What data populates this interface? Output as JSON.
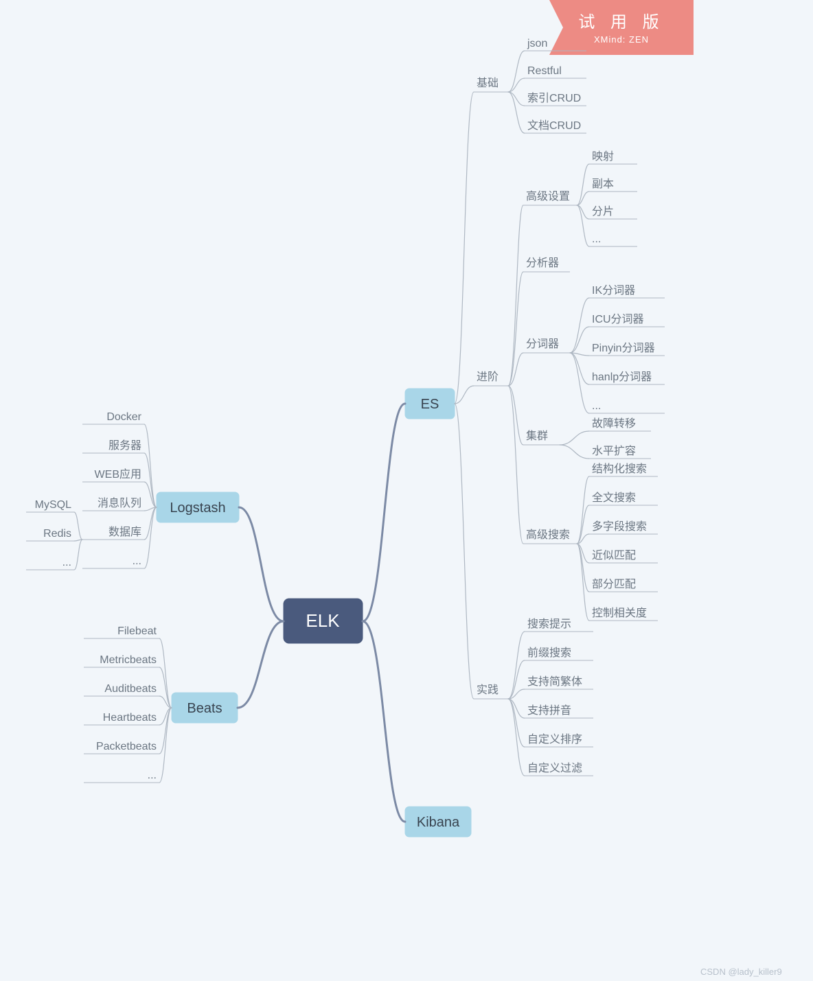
{
  "watermark": {
    "title": "试 用 版",
    "subtitle": "XMind: ZEN"
  },
  "footer": "CSDN @lady_killer9",
  "root": "ELK",
  "branches": {
    "logstash": "Logstash",
    "beats": "Beats",
    "es": "ES",
    "kibana": "Kibana"
  },
  "logstash_children": [
    "Docker",
    "服务器",
    "WEB应用",
    "消息队列",
    "数据库",
    "..."
  ],
  "database_children": [
    "MySQL",
    "Redis",
    "..."
  ],
  "beats_children": [
    "Filebeat",
    "Metricbeats",
    "Auditbeats",
    "Heartbeats",
    "Packetbeats",
    "..."
  ],
  "es_children": {
    "basic": "基础",
    "advanced": "进阶",
    "practice": "实践"
  },
  "basic_children": [
    "json",
    "Restful",
    "索引CRUD",
    "文档CRUD"
  ],
  "advanced_children": {
    "settings": "高级设置",
    "analyzer": "分析器",
    "tokenizer": "分词器",
    "cluster": "集群",
    "search": "高级搜索"
  },
  "settings_children": [
    "映射",
    "副本",
    "分片",
    "..."
  ],
  "tokenizer_children": [
    "IK分词器",
    "ICU分词器",
    "Pinyin分词器",
    "hanlp分词器",
    "..."
  ],
  "cluster_children": [
    "故障转移",
    "水平扩容"
  ],
  "search_children": [
    "结构化搜索",
    "全文搜索",
    "多字段搜索",
    "近似匹配",
    "部分匹配",
    "控制相关度"
  ],
  "practice_children": [
    "搜索提示",
    "前缀搜索",
    "支持简繁体",
    "支持拼音",
    "自定义排序",
    "自定义过滤"
  ]
}
